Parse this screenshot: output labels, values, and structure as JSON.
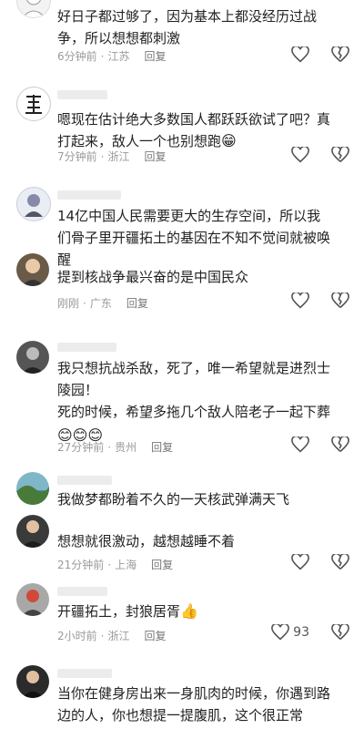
{
  "comments": [
    {
      "text": "好日子都过够了，因为基本上都没经历过战争，所以想想都刺激",
      "time": "6分钟前",
      "location": "江苏",
      "reply": "回复",
      "emoji": ""
    },
    {
      "text": "嗯现在估计绝大多数国人都跃跃欲试了吧？真打起来，敌人一个也别想跑",
      "time": "7分钟前",
      "location": "浙江",
      "reply": "回复",
      "emoji": "😁"
    },
    {
      "text": "14亿中国人民需要更大的生存空间，所以我们骨子里开疆拓土的基因在不知不觉间就被唤醒",
      "time": "",
      "location": "",
      "reply": "",
      "emoji": ""
    },
    {
      "text": "提到核战争最兴奋的是中国民众",
      "time": "刚刚",
      "location": "广东",
      "reply": "回复",
      "emoji": ""
    },
    {
      "text": "我只想抗战杀敌，死了，唯一希望就是进烈士陵园！",
      "text2": "死的时候，希望多拖几个敌人陪老子一起下葬",
      "time": "27分钟前",
      "location": "贵州",
      "reply": "回复",
      "emoji": "😊😊😊"
    },
    {
      "text": "我做梦都盼着不久的一天核武弹满天飞",
      "time": "",
      "location": "",
      "reply": "",
      "emoji": ""
    },
    {
      "text": "想想就很激动，越想越睡不着",
      "time": "21分钟前",
      "location": "上海",
      "reply": "回复",
      "emoji": ""
    },
    {
      "text": "开疆拓土，封狼居胥",
      "time": "2小时前",
      "location": "浙江",
      "reply": "回复",
      "emoji": "👍",
      "likes": "93"
    },
    {
      "text": "当你在健身房出来一身肌肉的时候，你遇到路边的人，你也想提一提腹肌，这个很正常",
      "time": "",
      "location": "",
      "reply": "",
      "emoji": ""
    }
  ],
  "icons": {
    "like": "heart-icon",
    "dislike": "broken-heart-icon"
  },
  "colors": {
    "text": "#222222",
    "meta": "#9a9a9a"
  }
}
